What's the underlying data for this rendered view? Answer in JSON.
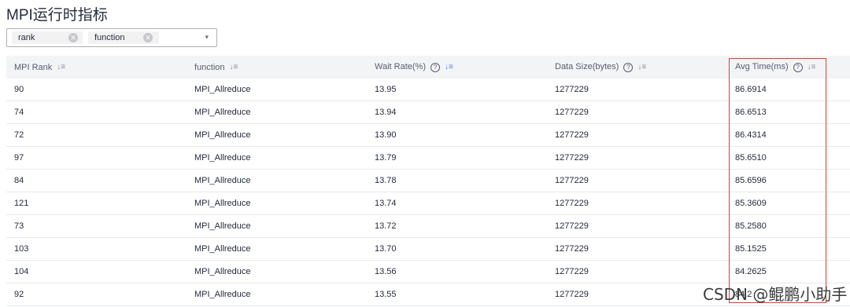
{
  "page": {
    "title": "MPI运行时指标"
  },
  "filter": {
    "tags": [
      {
        "label": "rank",
        "remove": "✕"
      },
      {
        "label": "function",
        "remove": "✕"
      }
    ],
    "caret": "▾"
  },
  "table": {
    "columns": [
      {
        "label": "MPI Rank",
        "help": "",
        "sort": "↓≡"
      },
      {
        "label": "function",
        "help": "",
        "sort": "↓≡"
      },
      {
        "label": "Wait Rate(%)",
        "help": "?",
        "sort": "↓≡"
      },
      {
        "label": "Data Size(bytes)",
        "help": "?",
        "sort": "↓≡"
      },
      {
        "label": "Avg Time(ms)",
        "help": "?",
        "sort": "↓≡"
      }
    ],
    "rows": [
      [
        "90",
        "MPI_Allreduce",
        "13.95",
        "1277229",
        "86.6914"
      ],
      [
        "74",
        "MPI_Allreduce",
        "13.94",
        "1277229",
        "86.6513"
      ],
      [
        "72",
        "MPI_Allreduce",
        "13.90",
        "1277229",
        "86.4314"
      ],
      [
        "97",
        "MPI_Allreduce",
        "13.79",
        "1277229",
        "85.6510"
      ],
      [
        "84",
        "MPI_Allreduce",
        "13.78",
        "1277229",
        "85.6596"
      ],
      [
        "121",
        "MPI_Allreduce",
        "13.74",
        "1277229",
        "85.3609"
      ],
      [
        "73",
        "MPI_Allreduce",
        "13.72",
        "1277229",
        "85.2580"
      ],
      [
        "103",
        "MPI_Allreduce",
        "13.70",
        "1277229",
        "85.1525"
      ],
      [
        "104",
        "MPI_Allreduce",
        "13.56",
        "1277229",
        "84.2625"
      ],
      [
        "92",
        "MPI_Allreduce",
        "13.55",
        "1277229",
        "84.2"
      ]
    ]
  },
  "watermark": "CSDN @鲲鹏小助手"
}
